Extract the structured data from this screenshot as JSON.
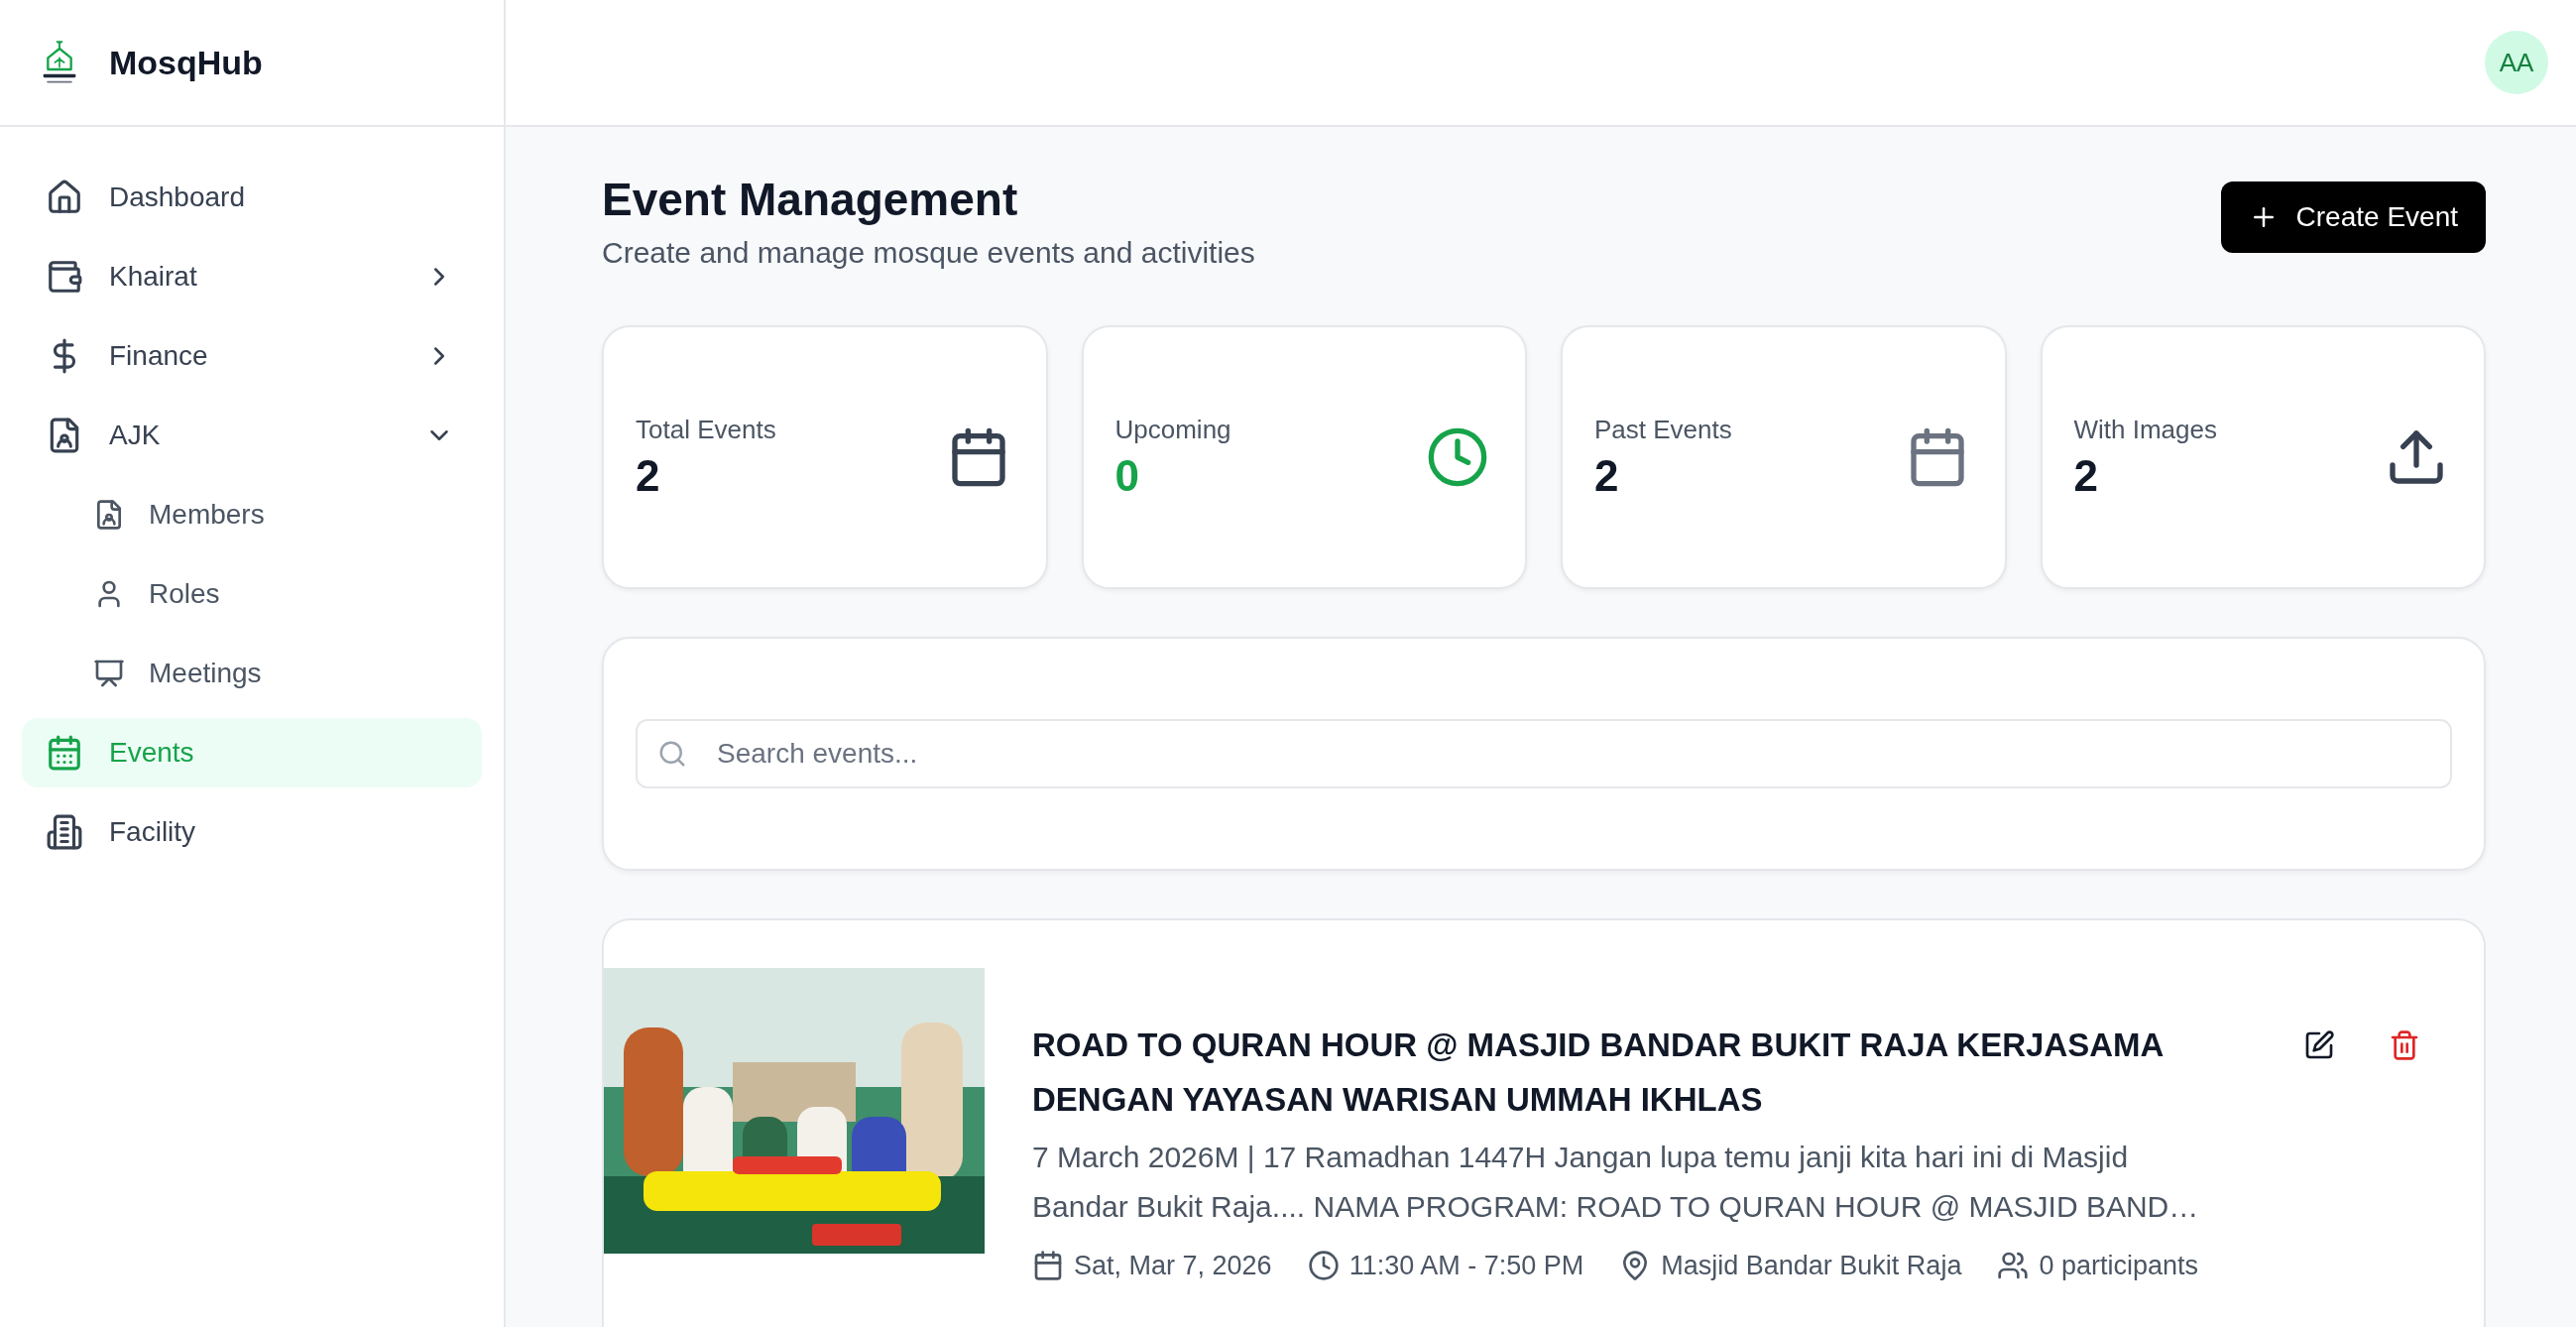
{
  "app": {
    "name": "MosqHub"
  },
  "sidebar": {
    "items": [
      {
        "label": "Dashboard",
        "selected": false
      },
      {
        "label": "Khairat",
        "selected": false,
        "expanded": false
      },
      {
        "label": "Finance",
        "selected": false,
        "expanded": false
      },
      {
        "label": "AJK",
        "selected": false,
        "expanded": true,
        "children": [
          {
            "label": "Members",
            "selected": false
          },
          {
            "label": "Roles",
            "selected": false
          },
          {
            "label": "Meetings",
            "selected": false
          }
        ]
      },
      {
        "label": "Events",
        "selected": true
      },
      {
        "label": "Facility",
        "selected": false
      }
    ]
  },
  "header": {
    "avatar": "AA"
  },
  "page": {
    "title": "Event Management",
    "subtitle": "Create and manage mosque events and activities",
    "create_button": "Create Event"
  },
  "stats": [
    {
      "label": "Total Events",
      "value": "2",
      "color": "#111827"
    },
    {
      "label": "Upcoming",
      "value": "0",
      "color": "#16a34a"
    },
    {
      "label": "Past Events",
      "value": "2",
      "color": "#111827"
    },
    {
      "label": "With Images",
      "value": "2",
      "color": "#111827"
    }
  ],
  "search": {
    "placeholder": "Search events..."
  },
  "events": [
    {
      "kind": "picture",
      "title": "ROAD TO QURAN HOUR @ MASJID BANDAR BUKIT RAJA KERJASAMA DENGAN YAYASAN WARISAN UMMAH IKHLAS",
      "description": "7 March 2026M | 17 Ramadhan 1447H Jangan lupa temu janji kita hari ini di Masjid Bandar Bukit Raja.... NAMA PROGRAM: ROAD TO QURAN HOUR @ MASJID BAND…",
      "date": "Sat, Mar 7, 2026",
      "time": "11:30 AM - 7:50 PM",
      "location": "Masjid Bandar Bukit Raja",
      "participants": "0 participants"
    }
  ]
}
